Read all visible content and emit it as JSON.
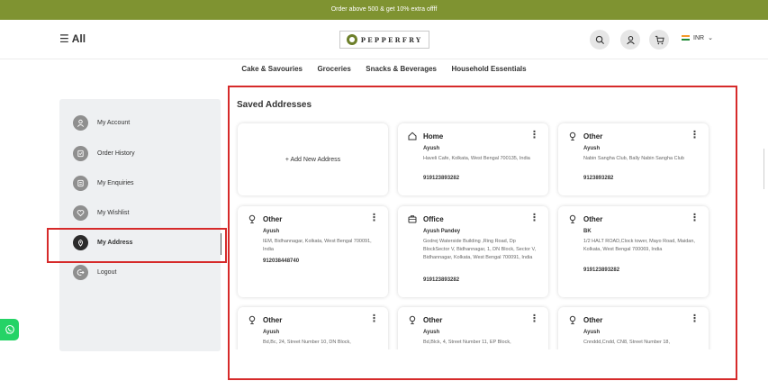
{
  "promo": {
    "text": "Order above 500 & get 10% extra offff"
  },
  "header": {
    "menu_label": "All",
    "logo_text": "PEPPERFRY",
    "currency": "INR"
  },
  "categories": [
    "Cake & Savouries",
    "Groceries",
    "Snacks & Beverages",
    "Household Essentials"
  ],
  "sidebar": {
    "items": [
      {
        "label": "My Account",
        "icon": "user-icon"
      },
      {
        "label": "Order History",
        "icon": "order-history-icon"
      },
      {
        "label": "My Enquiries",
        "icon": "enquiries-icon"
      },
      {
        "label": "My Wishlist",
        "icon": "heart-icon"
      },
      {
        "label": "My Address",
        "icon": "location-pin-icon",
        "active": true
      },
      {
        "label": "Logout",
        "icon": "logout-icon"
      }
    ]
  },
  "addresses": {
    "title": "Saved Addresses",
    "add_label": "+ Add New Address",
    "cards": [
      {
        "type": "Home",
        "icon": "home-icon",
        "name": "Ayush",
        "address": "Haveli Cafe, Kolkata, West Bengal 700135, India",
        "phone": "919123893282"
      },
      {
        "type": "Other",
        "icon": "pin-icon",
        "name": "Ayush",
        "address": "Nabin Sangha Club, Bally Nabin Sangha Club",
        "phone": "9123893282"
      },
      {
        "type": "Other",
        "icon": "pin-icon",
        "name": "Ayush",
        "address": "IEM, Bidhannagar, Kolkata, West Bengal 700091, India",
        "phone": "912038448740"
      },
      {
        "type": "Office",
        "icon": "briefcase-icon",
        "name": "Ayush Pandey",
        "address": "Godrej Waterside Building ,Ring Road, Dp BlockSector V, Bidhannagar, 1, DN Block, Sector V, Bidhannagar, Kolkata, West Bengal 700091, India",
        "phone": "919123893282"
      },
      {
        "type": "Other",
        "icon": "pin-icon",
        "name": "BK",
        "address": "1/2 HALT ROAD,Clock tower, Mayo Road, Maidan, Kolkata, West Bengal 700069, India",
        "phone": "919123893282"
      },
      {
        "type": "Other",
        "icon": "pin-icon",
        "name": "Ayush",
        "address": "Bd,Bc, 24, Street Number 10, DN Block,",
        "phone": ""
      },
      {
        "type": "Other",
        "icon": "pin-icon",
        "name": "Ayush",
        "address": "Bd,Blck, 4, Street Number 11, EP Block,",
        "phone": ""
      },
      {
        "type": "Other",
        "icon": "pin-icon",
        "name": "Ayush",
        "address": "Cnnddd,Cndd, CN8, Street Number 18,",
        "phone": ""
      }
    ]
  },
  "colors": {
    "promo_bg": "#7f9331",
    "highlight": "#d62a2a",
    "whatsapp": "#25d366"
  }
}
